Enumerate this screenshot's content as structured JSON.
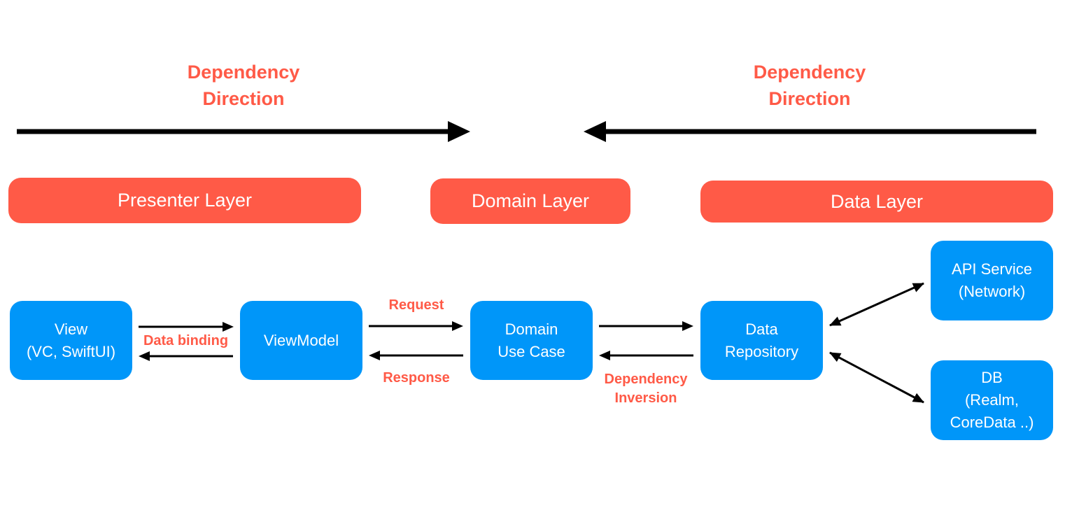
{
  "colors": {
    "accent": "#ff5a47",
    "node": "#0096f9",
    "arrow": "#000000",
    "background": "#ffffff"
  },
  "dependency_direction": {
    "left_label": "Dependency\nDirection",
    "right_label": "Dependency\nDirection",
    "left_arrow": "right-arrow-icon",
    "right_arrow": "left-arrow-icon"
  },
  "layers": {
    "presenter": "Presenter Layer",
    "domain": "Domain Layer",
    "data": "Data Layer"
  },
  "nodes": {
    "view": "View\n(VC, SwiftUI)",
    "viewmodel": "ViewModel",
    "usecase": "Domain\nUse Case",
    "repository": "Data\nRepository",
    "api": "API Service\n(Network)",
    "db": "DB\n(Realm,\nCoreData ..)"
  },
  "edge_labels": {
    "data_binding": "Data binding",
    "request": "Request",
    "response": "Response",
    "dependency_inversion": "Dependency\nInversion"
  }
}
